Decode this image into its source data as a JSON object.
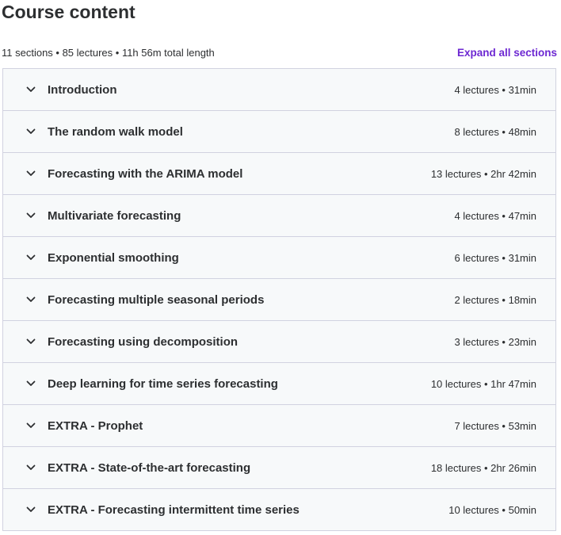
{
  "header": {
    "title": "Course content"
  },
  "summary": {
    "text": "11 sections • 85 lectures • 11h 56m total length",
    "expand_label": "Expand all sections"
  },
  "colors": {
    "link": "#6d28d2",
    "row_bg": "#f7f9fa",
    "border": "#d1d2e0",
    "text": "#2d2f31"
  },
  "sections": [
    {
      "title": "Introduction",
      "meta": "4 lectures • 31min",
      "icon": "chevron-down-icon"
    },
    {
      "title": "The random walk model",
      "meta": "8 lectures • 48min",
      "icon": "chevron-down-icon"
    },
    {
      "title": "Forecasting with the ARIMA model",
      "meta": "13 lectures • 2hr 42min",
      "icon": "chevron-down-icon"
    },
    {
      "title": "Multivariate forecasting",
      "meta": "4 lectures • 47min",
      "icon": "chevron-down-icon"
    },
    {
      "title": "Exponential smoothing",
      "meta": "6 lectures • 31min",
      "icon": "chevron-down-icon"
    },
    {
      "title": "Forecasting multiple seasonal periods",
      "meta": "2 lectures • 18min",
      "icon": "chevron-down-icon"
    },
    {
      "title": "Forecasting using decomposition",
      "meta": "3 lectures • 23min",
      "icon": "chevron-down-icon"
    },
    {
      "title": "Deep learning for time series forecasting",
      "meta": "10 lectures • 1hr 47min",
      "icon": "chevron-down-icon"
    },
    {
      "title": "EXTRA - Prophet",
      "meta": "7 lectures • 53min",
      "icon": "chevron-down-icon"
    },
    {
      "title": "EXTRA - State-of-the-art forecasting",
      "meta": "18 lectures • 2hr 26min",
      "icon": "chevron-down-icon"
    },
    {
      "title": "EXTRA - Forecasting intermittent time series",
      "meta": "10 lectures • 50min",
      "icon": "chevron-down-icon"
    }
  ]
}
